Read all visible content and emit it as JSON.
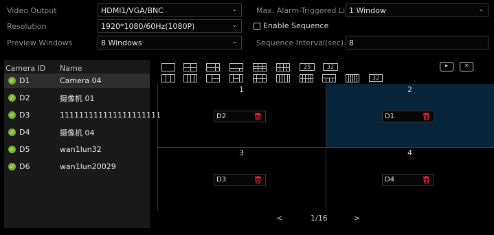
{
  "settings": {
    "video_output": {
      "label": "Video Output",
      "value": "HDMI1/VGA/BNC"
    },
    "resolution": {
      "label": "Resolution",
      "value": "1920*1080/60Hz(1080P)"
    },
    "preview_windows": {
      "label": "Preview Windows",
      "value": "8 Windows"
    },
    "max_alarm": {
      "label": "Max. Alarm-Triggered Li...",
      "value": "1 Window"
    },
    "enable_sequence": {
      "label": "Enable Sequence",
      "checked": false
    },
    "sequence_interval": {
      "label": "Sequence Interval(sec)",
      "value": "8"
    }
  },
  "camera_list": {
    "col_id": "Camera ID",
    "col_name": "Name",
    "rows": [
      {
        "id": "D1",
        "name": "Camera 04",
        "selected": true
      },
      {
        "id": "D2",
        "name": "摄像机 01",
        "selected": false
      },
      {
        "id": "D3",
        "name": "111111111111111111111",
        "selected": false
      },
      {
        "id": "D4",
        "name": "摄像机 04",
        "selected": false
      },
      {
        "id": "D5",
        "name": "wan1lun32",
        "selected": false
      },
      {
        "id": "D6",
        "name": "wan1lun20029",
        "selected": false
      }
    ]
  },
  "layout_toolbar": {
    "text_layouts": [
      "25",
      "32",
      "32"
    ],
    "action_icons": [
      "play-sequence-icon",
      "clear-all-icon"
    ]
  },
  "preview": {
    "cells": [
      {
        "number": "1",
        "camera": "D2",
        "selected": false
      },
      {
        "number": "2",
        "camera": "D1",
        "selected": true
      },
      {
        "number": "3",
        "camera": "D3",
        "selected": false
      },
      {
        "number": "4",
        "camera": "D4",
        "selected": false
      }
    ]
  },
  "pager": {
    "prev": "<",
    "page": "1/16",
    "next": ">"
  },
  "colors": {
    "accent_selected": "#07243a",
    "online": "#7bb52f",
    "delete": "#e0262f"
  }
}
